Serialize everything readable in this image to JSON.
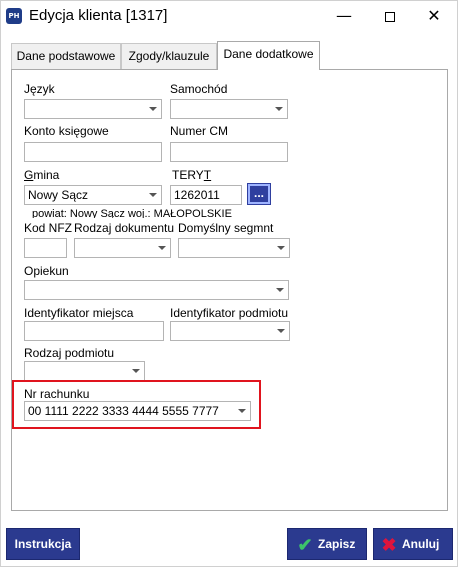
{
  "window": {
    "title": "Edycja klienta [1317]",
    "app_icon_text": "PH",
    "minimize_glyph": "—",
    "close_glyph": "✕"
  },
  "tabs": [
    {
      "label": "Dane podstawowe",
      "active": false
    },
    {
      "label": "Zgody/klauzule",
      "active": false
    },
    {
      "label": "Dane dodatkowe",
      "active": true
    }
  ],
  "form": {
    "jezyk": {
      "label": "Język",
      "value": ""
    },
    "samochod": {
      "label": "Samochód",
      "value": ""
    },
    "konto": {
      "label": "Konto księgowe",
      "value": ""
    },
    "numer_cm": {
      "label": "Numer CM",
      "value": ""
    },
    "gmina": {
      "label_accel": "G",
      "label_rest": "mina",
      "value": "Nowy Sącz"
    },
    "teryt": {
      "label_main": "TERY",
      "label_accel": "T",
      "value": "1262011",
      "lookup_label": "..."
    },
    "gmina_hint": "powiat: Nowy Sącz woj.: MAŁOPOLSKIE",
    "kod_nfz": {
      "label": "Kod NFZ",
      "value": ""
    },
    "rodzaj_dokumentu": {
      "label": "Rodzaj dokumentu",
      "value": ""
    },
    "domyslny_segment": {
      "label": "Domyślny segmnt",
      "value": ""
    },
    "opiekun": {
      "label": "Opiekun",
      "value": ""
    },
    "id_miejsca": {
      "label": "Identyfikator miejsca",
      "value": ""
    },
    "id_podmiotu": {
      "label": "Identyfikator podmiotu",
      "value": ""
    },
    "rodzaj_podmiotu": {
      "label": "Rodzaj podmiotu",
      "value": ""
    },
    "nr_rachunku": {
      "label": "Nr rachunku",
      "value": "00 1111 2222 3333 4444 5555 7777"
    }
  },
  "buttons": {
    "instrukcja": "Instrukcja",
    "zapisz": "Zapisz",
    "anuluj": "Anuluj"
  },
  "colors": {
    "button_bg": "#2b3a8f",
    "highlight": "#e0141e",
    "check": "#3cc36a",
    "cross": "#e0143c"
  },
  "icons": {
    "zapisz": "checkmark-icon",
    "anuluj": "x-icon"
  }
}
